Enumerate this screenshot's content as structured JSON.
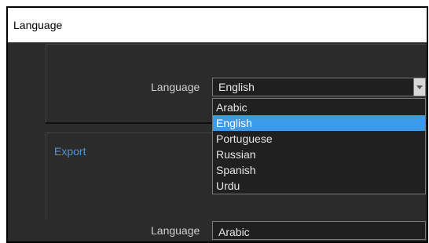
{
  "window": {
    "title": "Language"
  },
  "language_section": {
    "label": "Language",
    "selected_value": "English"
  },
  "export_section": {
    "title": "Export",
    "label": "Language",
    "selected_value": "Arabic"
  },
  "dropdown": {
    "options": [
      "Arabic",
      "English",
      "Portuguese",
      "Russian",
      "Spanish",
      "Urdu"
    ],
    "highlighted": "English"
  },
  "colors": {
    "accent": "#3d9ae8",
    "export_title": "#4f95d6",
    "background": "#2b2b2b"
  },
  "icons": {
    "combo_arrow": "chevron-down-icon"
  }
}
